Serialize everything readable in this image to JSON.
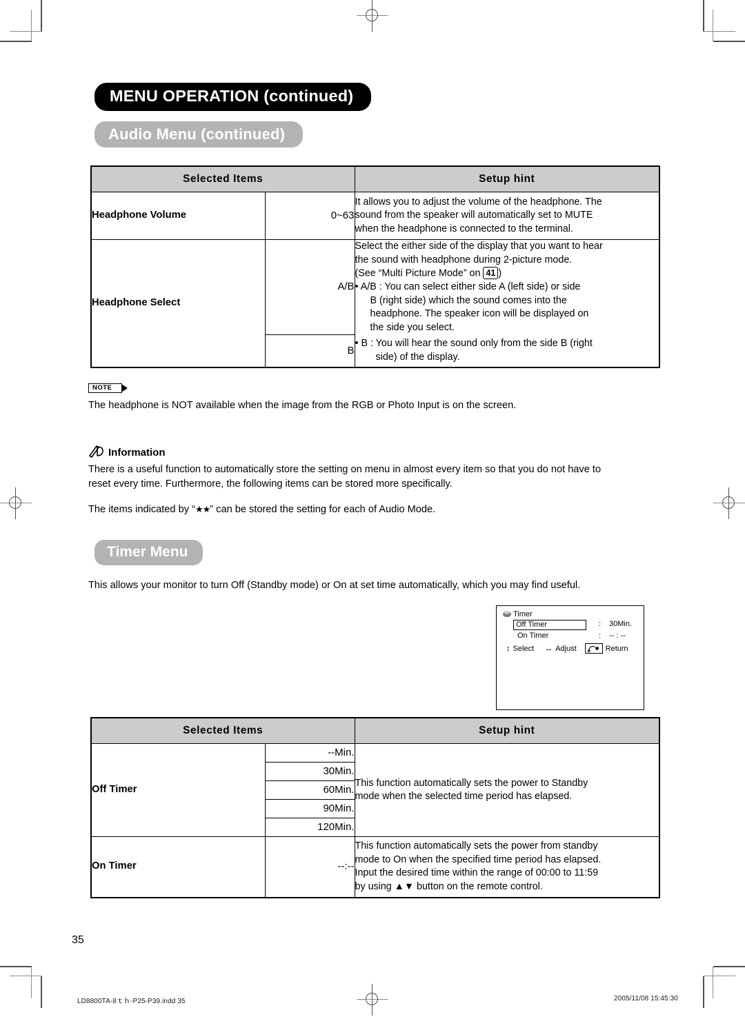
{
  "header": {
    "chapter_title": "MENU OPERATION (continued)",
    "section_title": "Audio Menu (continued)"
  },
  "audio_table": {
    "columns": [
      "Selected Items",
      "Setup hint"
    ],
    "rows": [
      {
        "item": "Headphone Volume",
        "values": [
          "0~63"
        ],
        "hint_lines": [
          "It allows you to adjust the volume of the headphone. The",
          "sound from the speaker will automatically set to MUTE",
          "when the headphone is connected to the terminal."
        ]
      },
      {
        "item": "Headphone Select",
        "values": [
          "A/B",
          "B"
        ],
        "hint_lines": [
          "Select the either side of the display that you want to hear",
          "the sound with headphone during 2-picture mode.",
          "(See “Multi Picture Mode” on 41 )",
          "• A/B : You can select either side A (left side) or side",
          "B (right side) which the sound comes into the",
          "headphone. The speaker icon will be displayed on",
          "the side you select."
        ],
        "hint_lines_2": [
          "• B    : You will hear the sound only from the side B (right",
          "side) of the display."
        ],
        "page_ref": "41"
      }
    ]
  },
  "note": {
    "badge": "NOTE",
    "text": "The headphone is NOT available when the image from the RGB or Photo Input is on the screen."
  },
  "information": {
    "heading": "Information",
    "paragraph1_line1": "There is a useful function to automatically store the setting on menu in almost every item so that you do not have to",
    "paragraph1_line2": "reset every time. Furthermore, the following items can be stored more specifically.",
    "paragraph2_pre": "The items indicated by “",
    "paragraph2_symbol": "★★",
    "paragraph2_post": "” can be stored the setting for each of Audio Mode."
  },
  "timer_section": {
    "title": "Timer Menu",
    "intro": "This allows your monitor to turn Off (Standby mode) or On at set time automatically, which you may find useful."
  },
  "osd": {
    "title": "Timer",
    "off_timer_label": "Off Timer",
    "off_timer_colon": ":",
    "off_timer_value": "30Min.",
    "on_timer_label": "On Timer",
    "on_timer_colon": ":",
    "on_timer_value": "-- : --",
    "select_icon": "↕",
    "select_label": "Select",
    "adjust_icon": "↔",
    "adjust_label": "Adjust",
    "return_label": "Return"
  },
  "timer_table": {
    "columns": [
      "Selected Items",
      "Setup hint"
    ],
    "rows": [
      {
        "item": "Off Timer",
        "values": [
          "--Min.",
          "30Min.",
          "60Min.",
          "90Min.",
          "120Min."
        ],
        "hint_lines": [
          "This function automatically sets the power to Standby",
          "mode when the selected time period has elapsed."
        ]
      },
      {
        "item": "On Timer",
        "values": [
          "--:--"
        ],
        "hint_lines": [
          "This function automatically sets the power from standby",
          "mode to On when the specified time period has elapsed.",
          "Input the desired time within the range of 00:00 to 11:59",
          "by using ▲▼ button on the remote control."
        ]
      }
    ]
  },
  "footer": {
    "page_number": "35",
    "file_info": "LD8800TA-8ｔｈ-P25-P39.indd   35",
    "timestamp": "2005/11/08   15:45:30"
  }
}
